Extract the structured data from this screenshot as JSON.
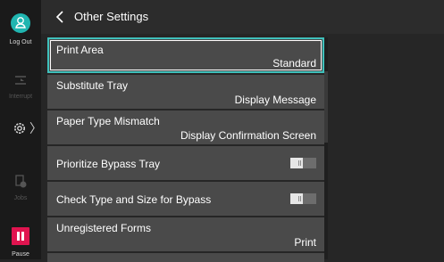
{
  "rail": {
    "logout_label": "Log Out",
    "interrupt_label": "Interrupt",
    "jobs_label": "Jobs",
    "pause_label": "Pause",
    "logout_color": "#20b5b0",
    "pause_color": "#e0144f"
  },
  "header": {
    "title": "Other Settings",
    "back_icon": "chevron-left-icon"
  },
  "settings": {
    "items": [
      {
        "label": "Print Area",
        "value": "Standard",
        "selected": true
      },
      {
        "label": "Substitute Tray",
        "value": "Display Message"
      },
      {
        "label": "Paper Type Mismatch",
        "value": "Display Confirmation Screen"
      },
      {
        "label": "Prioritize Bypass Tray",
        "toggle": "off"
      },
      {
        "label": "Check Type and Size for Bypass",
        "toggle": "off"
      },
      {
        "label": "Unregistered Forms",
        "value": "Print"
      }
    ]
  },
  "colors": {
    "accent": "#3fc0bb",
    "item_bg": "#4a4a4a",
    "background": "#262626"
  }
}
